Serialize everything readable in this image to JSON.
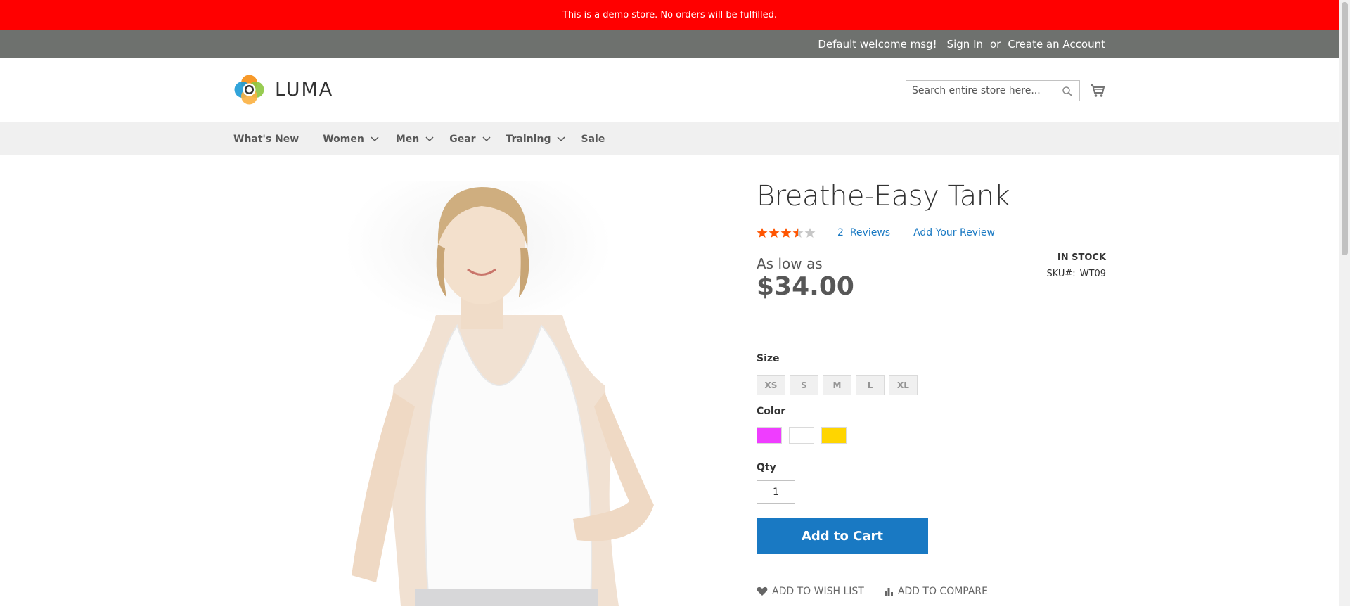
{
  "demo_notice": "This is a demo store. No orders will be fulfilled.",
  "top_bar": {
    "welcome": "Default welcome msg!",
    "sign_in": "Sign In",
    "or": "or",
    "create_account": "Create an Account"
  },
  "logo": {
    "text": "LUMA"
  },
  "search": {
    "placeholder": "Search entire store here..."
  },
  "nav": {
    "items": [
      {
        "label": "What's New"
      },
      {
        "label": "Women"
      },
      {
        "label": "Men"
      },
      {
        "label": "Gear"
      },
      {
        "label": "Training"
      },
      {
        "label": "Sale"
      }
    ]
  },
  "product": {
    "title": "Breathe-Easy Tank",
    "rating_stars": 3.5,
    "rating_max": 5,
    "reviews_count": "2",
    "reviews_label": "Reviews",
    "add_review": "Add Your Review",
    "as_low_as": "As low as",
    "price": "$34.00",
    "stock": "IN STOCK",
    "sku_label": "SKU#:",
    "sku": "WT09",
    "size_label": "Size",
    "sizes": [
      "XS",
      "S",
      "M",
      "L",
      "XL"
    ],
    "color_label": "Color",
    "colors": [
      "#ef3dff",
      "#ffffff",
      "#ffd500"
    ],
    "qty_label": "Qty",
    "qty": "1",
    "add_to_cart": "Add to Cart",
    "wish_list": "Add to Wish List",
    "compare": "Add to Compare"
  },
  "colors": {
    "demo_bar": "#ff0000",
    "top_bar": "#6e716e",
    "nav_bg": "#f0f0f0",
    "accent": "#1979c3",
    "star": "#ff5501"
  }
}
